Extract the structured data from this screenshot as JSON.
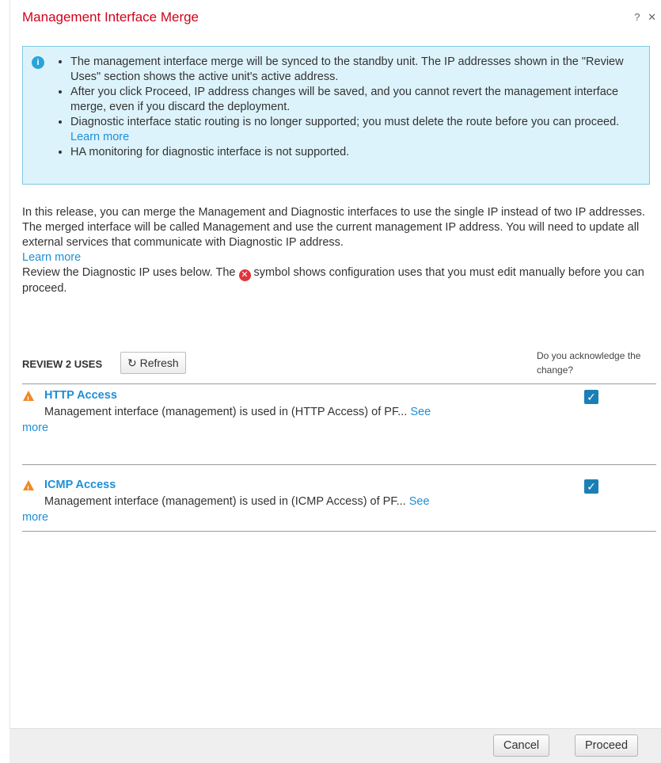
{
  "dialog": {
    "title": "Management Interface Merge",
    "help_label": "?",
    "close_label": "✕"
  },
  "info": {
    "bullet1": "The management interface merge will be synced to the standby unit. The IP addresses shown in the \"Review Uses\" section shows the active unit's active address.",
    "bullet2": "After you click Proceed, IP address changes will be saved, and you cannot revert the management interface merge, even if you discard the deployment.",
    "bullet3": "Diagnostic interface static routing is no longer supported; you must delete the route before you can proceed.",
    "bullet3_link": "Learn more",
    "bullet4": "HA monitoring for diagnostic interface is not supported."
  },
  "description": {
    "para1": "In this release, you can merge the Management and Diagnostic interfaces to use the single IP instead of two IP addresses. The merged interface will be called Management and use the current management IP address. You will need to update all external services that communicate with Diagnostic IP address.",
    "learn_more": "Learn more",
    "review_prefix": "Review the Diagnostic IP uses below. The",
    "review_suffix": "symbol shows configuration uses that you must edit manually before you can proceed."
  },
  "review": {
    "title": "REVIEW 2 USES",
    "refresh_label": "Refresh",
    "ack_label": "Do you acknowledge the change?",
    "uses": [
      {
        "title": "HTTP Access",
        "description": "Management interface (management) is used in (HTTP Access) of PF...",
        "see": "See",
        "more": "more",
        "acknowledged": true
      },
      {
        "title": "ICMP Access",
        "description": "Management interface (management) is used in (ICMP Access) of PF...",
        "see": "See",
        "more": "more",
        "acknowledged": true
      }
    ]
  },
  "footer": {
    "cancel_label": "Cancel",
    "proceed_label": "Proceed"
  },
  "colors": {
    "title": "#d0021b",
    "link": "#1d8fd6",
    "info_bg": "#ddf3fb",
    "warning": "#f08a24",
    "checkbox": "#1a7fb5"
  }
}
